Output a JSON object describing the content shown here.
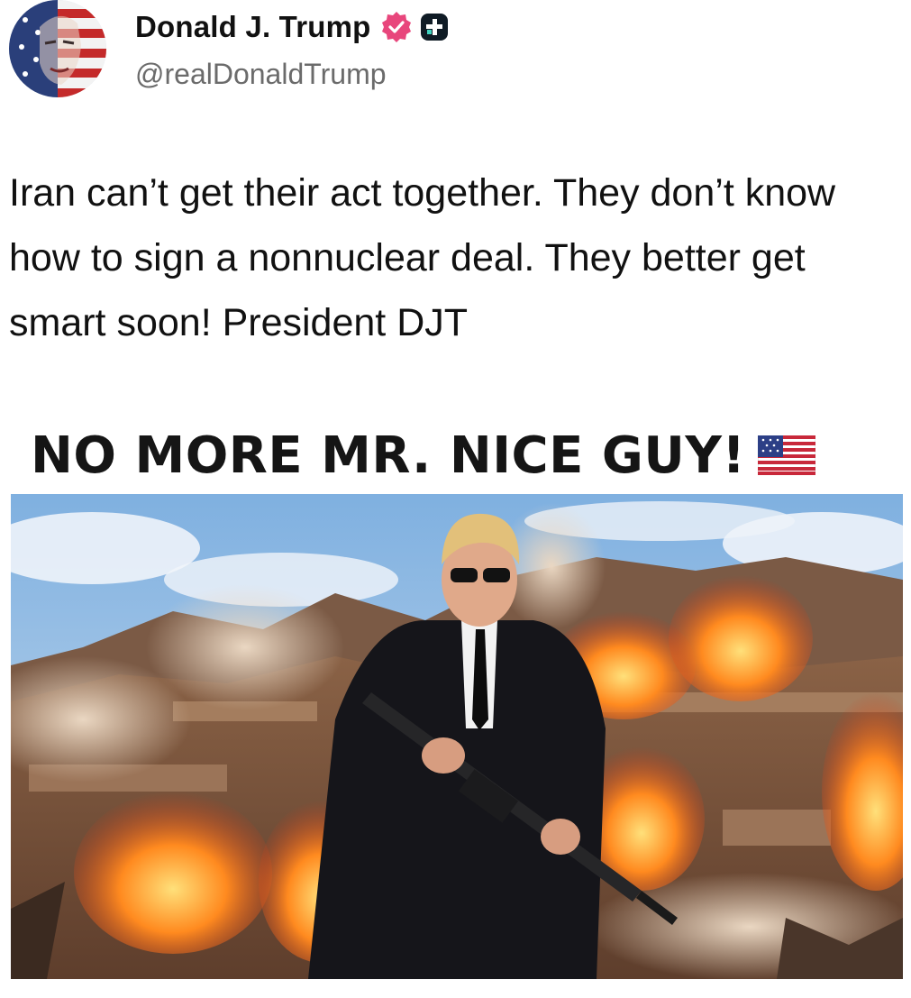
{
  "author": {
    "display_name": "Donald J. Trump",
    "handle": "@realDonaldTrump",
    "avatar_icon": "flag-portrait-avatar",
    "verified_icon": "verified-badge-icon",
    "verified_color": "#e8467c",
    "extra_badge_icon": "plus-badge-icon"
  },
  "post": {
    "text": "Iran can’t get their act together. They don’t know how to sign a nonnuclear deal. They better get smart soon! President DJT"
  },
  "media": {
    "headline": "NO MORE MR. NICE GUY!",
    "headline_icon": "us-flag-emoji-icon",
    "photo_subject": "man-in-suit-with-rifle-explosions"
  }
}
